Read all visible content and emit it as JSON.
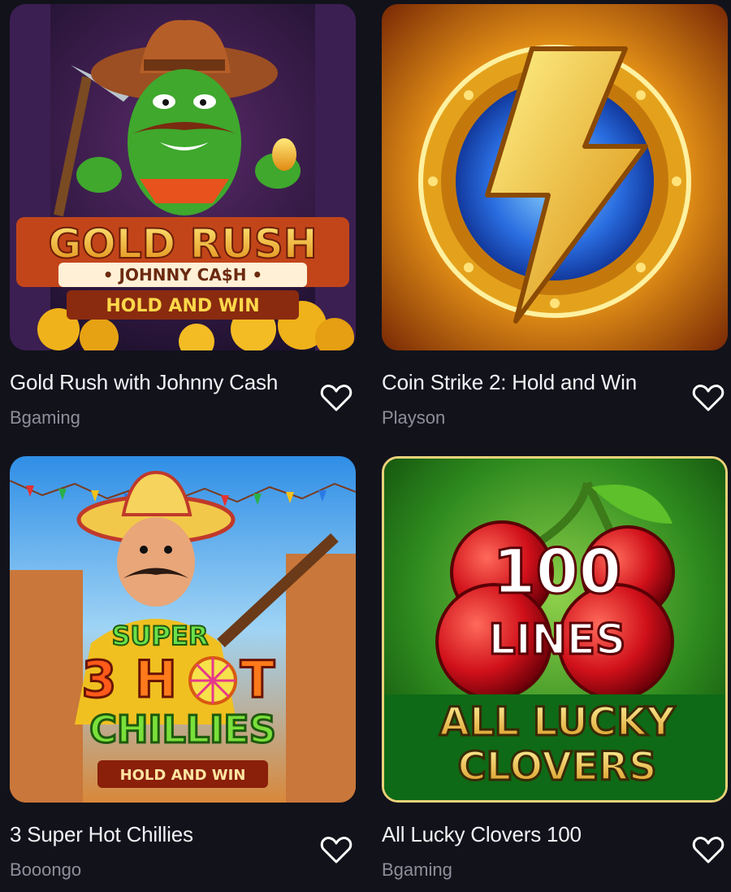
{
  "games": [
    {
      "title": "Gold Rush with Johnny Cash",
      "provider": "Bgaming",
      "art": {
        "line1": "GOLD RUSH",
        "line2": "• JOHNNY CA$H •",
        "line3": "HOLD AND WIN"
      }
    },
    {
      "title": "Coin Strike 2: Hold and Win",
      "provider": "Playson",
      "art": {}
    },
    {
      "title": "3 Super Hot Chillies",
      "provider": "Booongo",
      "art": {
        "line1": "SUPER",
        "line2": "3",
        "line3": "H",
        "line4": "T",
        "line5": "CHILLIES",
        "line6": "HOLD AND WIN"
      }
    },
    {
      "title": "All Lucky Clovers 100",
      "provider": "Bgaming",
      "art": {
        "line1": "100",
        "line2": "LINES",
        "line3": "ALL LUCKY",
        "line4": "CLOVERS"
      }
    }
  ],
  "icons": {
    "favorite": "heart-outline-icon"
  },
  "colors": {
    "background": "#12121b",
    "title": "#f2f2f5",
    "provider": "#8e8f9b"
  }
}
